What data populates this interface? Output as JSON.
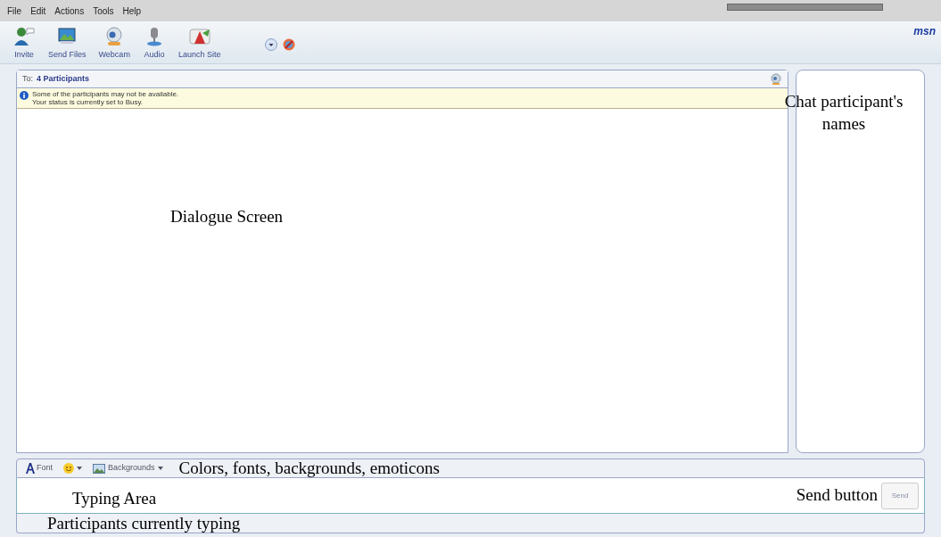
{
  "menu": [
    {
      "label": "File"
    },
    {
      "label": "Edit"
    },
    {
      "label": "Actions"
    },
    {
      "label": "Tools"
    },
    {
      "label": "Help"
    }
  ],
  "toolbar": [
    {
      "label": "Invite",
      "kind": "person"
    },
    {
      "label": "Send Files",
      "kind": "files"
    },
    {
      "label": "Webcam",
      "kind": "webcam"
    },
    {
      "label": "Audio",
      "kind": "audio"
    },
    {
      "label": "Launch Site",
      "kind": "site"
    }
  ],
  "brand": "msn",
  "conversation": {
    "to_label": "To:",
    "participants": "4 Participants",
    "notice": [
      "Some of the participants may not be available.",
      "Your status is currently set to Busy."
    ],
    "annotation": "Dialogue Screen"
  },
  "participants_panel": {
    "annotation": "Chat participant's names"
  },
  "format_bar": {
    "font": "Font",
    "backgrounds": "Backgrounds",
    "annotation": "Colors, fonts, backgrounds, emoticons"
  },
  "typing_area": {
    "annotation": "Typing Area",
    "send_annotation": "Send button",
    "send_button": "Send"
  },
  "status_bar": {
    "annotation": "Participants currently typing"
  }
}
